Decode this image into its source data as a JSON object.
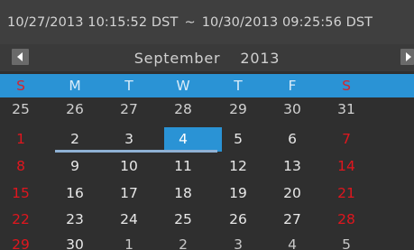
{
  "range": {
    "start": "10/27/2013 10:15:52 DST",
    "separator": "~",
    "end": "10/30/2013 09:25:56 DST"
  },
  "calendar": {
    "month": "September",
    "year": "2013",
    "prev_icon": "triangle-left-icon",
    "next_icon": "triangle-right-icon",
    "weekdays": [
      "S",
      "M",
      "T",
      "W",
      "T",
      "F",
      "S"
    ],
    "weeks": [
      [
        "25",
        "26",
        "27",
        "28",
        "29",
        "30",
        "31"
      ],
      [
        "1",
        "2",
        "3",
        "4",
        "5",
        "6",
        "7"
      ],
      [
        "8",
        "9",
        "10",
        "11",
        "12",
        "13",
        "14"
      ],
      [
        "15",
        "16",
        "17",
        "18",
        "19",
        "20",
        "21"
      ],
      [
        "22",
        "23",
        "24",
        "25",
        "26",
        "27",
        "28"
      ],
      [
        "29",
        "30",
        "1",
        "2",
        "3",
        "4",
        "5"
      ]
    ],
    "selected_day": "4",
    "marked_days": [
      "2",
      "3",
      "4"
    ]
  },
  "colors": {
    "background": "#2f2f2f",
    "header_blue": "#2a93d5",
    "weekend_red": "#e0161e",
    "underline": "#8fb1d4"
  }
}
